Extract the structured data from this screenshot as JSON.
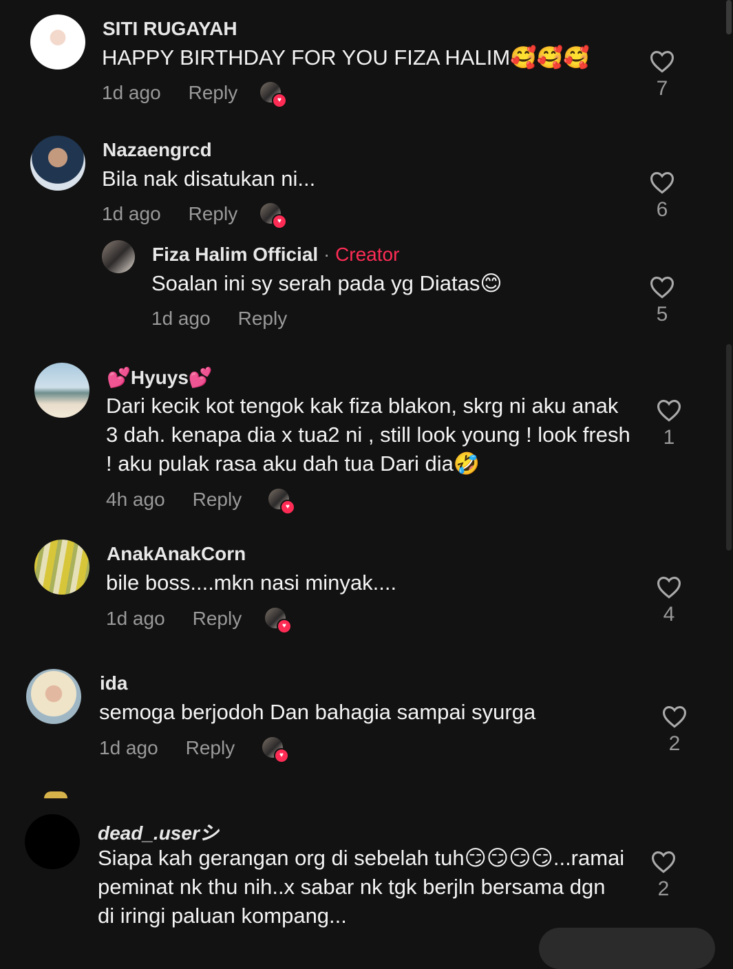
{
  "comments": [
    {
      "name": "SITI RUGAYAH",
      "text": "HAPPY BIRTHDAY FOR YOU FIZA HALIM🥰🥰🥰",
      "time": "1d ago",
      "reply": "Reply",
      "likes": "7",
      "creator_liked": true
    },
    {
      "name": "Nazaengrcd",
      "text": "Bila nak disatukan ni...",
      "time": "1d ago",
      "reply": "Reply",
      "likes": "6",
      "creator_liked": true
    },
    {
      "name": "Fiza Halim Official",
      "separator": "·",
      "badge": "Creator",
      "text": "Soalan ini sy serah pada yg Diatas😊",
      "time": "1d ago",
      "reply": "Reply",
      "likes": "5"
    },
    {
      "name": "💕Hyuys💕",
      "text": "Dari kecik kot tengok kak fiza blakon, skrg ni aku anak 3 dah. kenapa dia x tua2 ni , still look young ! look fresh ! aku pulak rasa aku dah tua Dari dia🤣",
      "time": "4h ago",
      "reply": "Reply",
      "likes": "1",
      "creator_liked": true
    },
    {
      "name": "AnakAnakCorn",
      "text": "bile boss....mkn nasi minyak....",
      "time": "1d ago",
      "reply": "Reply",
      "likes": "4",
      "creator_liked": true
    },
    {
      "name": "ida",
      "text": "semoga berjodoh Dan bahagia sampai syurga",
      "time": "1d ago",
      "reply": "Reply",
      "likes": "2",
      "creator_liked": true
    },
    {
      "name": "dead_.userシ",
      "text": "Siapa kah gerangan org di sebelah tuh😏😏😏😏...ramai peminat nk thu nih..x sabar nk tgk berjln bersama dgn di iringi paluan kompang...",
      "likes": "2"
    }
  ],
  "colors": {
    "background": "#121212",
    "creator_badge": "#fe2c55",
    "secondary_text": "#9a9a9a"
  },
  "icons": {
    "like": "heart-outline-icon",
    "creator_like": "creator-liked-heart-icon"
  }
}
